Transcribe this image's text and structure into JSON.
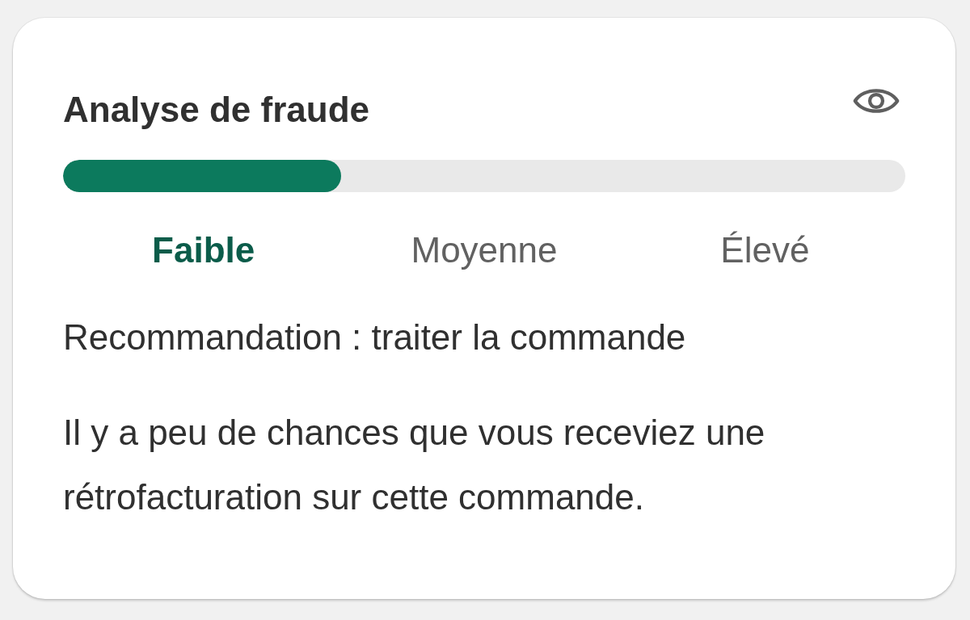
{
  "card": {
    "title": "Analyse de fraude",
    "meter": {
      "level": 0.33
    },
    "risk_levels": [
      {
        "label": "Faible",
        "selected": true
      },
      {
        "label": "Moyenne",
        "selected": false
      },
      {
        "label": "Élevé",
        "selected": false
      }
    ],
    "recommendation": "Recommandation : traiter la commande",
    "description": "Il y a peu de chances que vous receviez une rétrofacturation sur cette commande."
  }
}
